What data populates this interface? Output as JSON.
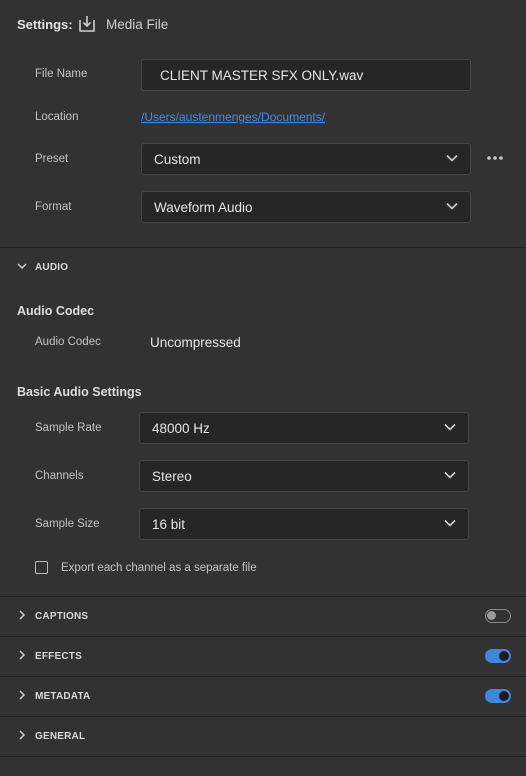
{
  "header": {
    "settings_label": "Settings:",
    "title": "Media File",
    "icon": "export-icon"
  },
  "file_settings": {
    "file_name_label": "File Name",
    "file_name_value": "CLIENT MASTER SFX ONLY.wav",
    "location_label": "Location",
    "location_value": "/Users/austenmenges/Documents/",
    "preset_label": "Preset",
    "preset_value": "Custom",
    "format_label": "Format",
    "format_value": "Waveform Audio"
  },
  "audio": {
    "section_title": "AUDIO",
    "codec_heading": "Audio Codec",
    "codec_label": "Audio Codec",
    "codec_value": "Uncompressed",
    "basic_heading": "Basic Audio Settings",
    "sample_rate_label": "Sample Rate",
    "sample_rate_value": "48000 Hz",
    "channels_label": "Channels",
    "channels_value": "Stereo",
    "sample_size_label": "Sample Size",
    "sample_size_value": "16 bit",
    "separate_file_label": "Export each channel as a separate file",
    "separate_file_checked": false
  },
  "sections": {
    "captions": {
      "title": "CAPTIONS",
      "enabled": false
    },
    "effects": {
      "title": "EFFECTS",
      "enabled": true
    },
    "metadata": {
      "title": "METADATA",
      "enabled": true
    },
    "general": {
      "title": "GENERAL"
    }
  },
  "colors": {
    "background": "#323232",
    "field": "#262626",
    "accent": "#3e86de",
    "link": "#3b8ef0"
  }
}
